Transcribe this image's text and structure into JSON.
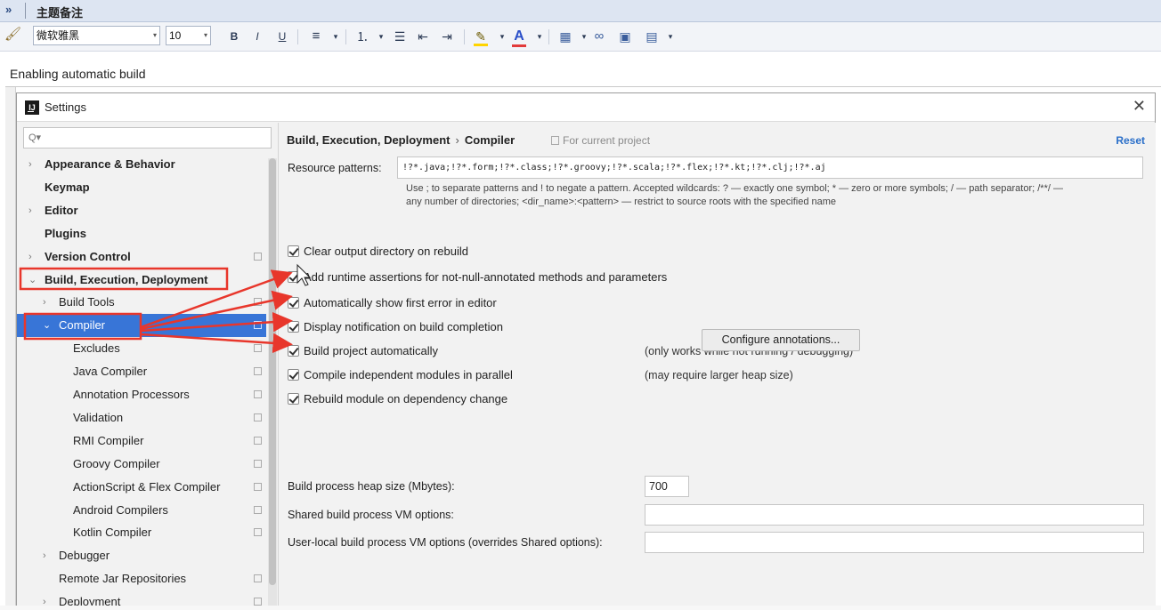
{
  "note_editor": {
    "expand_glyph": "»",
    "title": "主题备注",
    "toolbar": {
      "font_name": "微软雅黑",
      "font_size": "10",
      "bold": "B",
      "italic": "I",
      "underline": "U",
      "align": "≡",
      "numbered_list": "⒈",
      "bullet_list": "☰",
      "indent_less": "⇤",
      "indent_more": "⇥",
      "highlight": "✎",
      "font_color": "A",
      "table": "▦",
      "link": "∞",
      "image": "▣",
      "insert": "▤",
      "dropdown": "▾"
    },
    "caption": "Enabling automatic build"
  },
  "dialog": {
    "title": "Settings",
    "close": "✕",
    "search_icon": "Q▾",
    "tree": [
      {
        "label": "Appearance & Behavior",
        "expandable": true,
        "bold": true,
        "proj": false
      },
      {
        "label": "Keymap",
        "expandable": false,
        "bold": true,
        "proj": false
      },
      {
        "label": "Editor",
        "expandable": true,
        "bold": true,
        "proj": false
      },
      {
        "label": "Plugins",
        "expandable": false,
        "bold": true,
        "proj": false
      },
      {
        "label": "Version Control",
        "expandable": true,
        "bold": true,
        "proj": true
      },
      {
        "label": "Build, Execution, Deployment",
        "expandable": true,
        "bold": true,
        "proj": false,
        "expanded": true
      },
      {
        "label": "Build Tools",
        "expandable": true,
        "bold": false,
        "proj": true
      },
      {
        "label": "Compiler",
        "expandable": true,
        "bold": false,
        "proj": true,
        "expanded": true,
        "selected": true
      },
      {
        "label": "Excludes",
        "expandable": false,
        "bold": false,
        "proj": true
      },
      {
        "label": "Java Compiler",
        "expandable": false,
        "bold": false,
        "proj": true
      },
      {
        "label": "Annotation Processors",
        "expandable": false,
        "bold": false,
        "proj": true
      },
      {
        "label": "Validation",
        "expandable": false,
        "bold": false,
        "proj": true
      },
      {
        "label": "RMI Compiler",
        "expandable": false,
        "bold": false,
        "proj": true
      },
      {
        "label": "Groovy Compiler",
        "expandable": false,
        "bold": false,
        "proj": true
      },
      {
        "label": "ActionScript & Flex Compiler",
        "expandable": false,
        "bold": false,
        "proj": true
      },
      {
        "label": "Android Compilers",
        "expandable": false,
        "bold": false,
        "proj": true
      },
      {
        "label": "Kotlin Compiler",
        "expandable": false,
        "bold": false,
        "proj": true
      },
      {
        "label": "Debugger",
        "expandable": true,
        "bold": false,
        "proj": false
      },
      {
        "label": "Remote Jar Repositories",
        "expandable": false,
        "bold": false,
        "proj": true
      },
      {
        "label": "Deployment",
        "expandable": true,
        "bold": false,
        "proj": true
      }
    ],
    "content": {
      "breadcrumb_parent": "Build, Execution, Deployment",
      "breadcrumb_sep": "›",
      "breadcrumb_current": "Compiler",
      "scope_note": "For current project",
      "reset": "Reset",
      "resource_patterns_label": "Resource patterns:",
      "resource_patterns_value": "!?*.java;!?*.form;!?*.class;!?*.groovy;!?*.scala;!?*.flex;!?*.kt;!?*.clj;!?*.aj",
      "resource_help_1": "Use ; to separate patterns and ! to negate a pattern. Accepted wildcards: ? — exactly one symbol; * — zero or more symbols; / — path separator; /**/ —",
      "resource_help_2": "any number of directories; <dir_name>:<pattern> — restrict to source roots with the specified name",
      "checkboxes": [
        {
          "label": "Clear output directory on rebuild",
          "checked": true,
          "note": ""
        },
        {
          "label": "Add runtime assertions for not-null-annotated methods and parameters",
          "checked": true,
          "note": ""
        },
        {
          "label": "Automatically show first error in editor",
          "checked": true,
          "note": ""
        },
        {
          "label": "Display notification on build completion",
          "checked": true,
          "note": ""
        },
        {
          "label": "Build project automatically",
          "checked": true,
          "note": "(only works while not running / debugging)"
        },
        {
          "label": "Compile independent modules in parallel",
          "checked": true,
          "note": "(may require larger heap size)"
        },
        {
          "label": "Rebuild module on dependency change",
          "checked": true,
          "note": ""
        }
      ],
      "configure_button": "Configure annotations...",
      "heap_label": "Build process heap size (Mbytes):",
      "heap_value": "700",
      "shared_vm_label": "Shared build process VM options:",
      "shared_vm_value": "",
      "user_vm_label": "User-local build process VM options (overrides Shared options):",
      "user_vm_value": ""
    }
  },
  "colors": {
    "annotation_red": "#e8362b",
    "selection_blue": "#3875d7",
    "link_blue": "#2a6fc9"
  }
}
